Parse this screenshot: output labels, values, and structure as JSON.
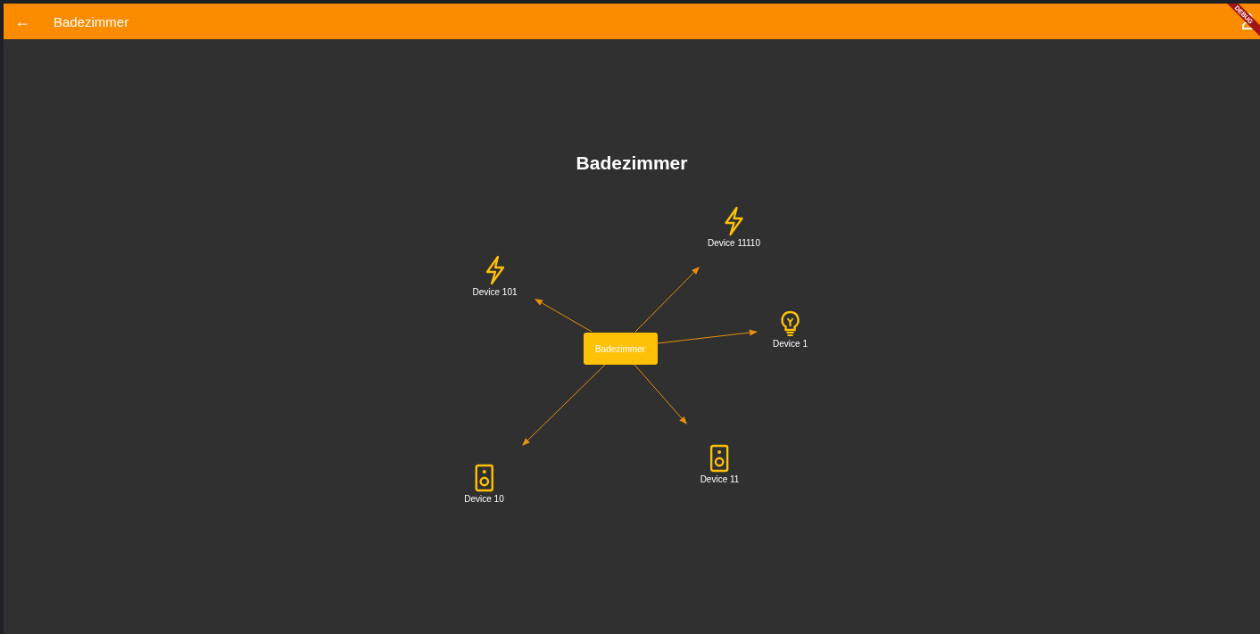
{
  "app_bar": {
    "back": "←",
    "title": "Badezimmer"
  },
  "debug_banner": "DEBUG",
  "heading": "Badezimmer",
  "diagram": {
    "center": "Badezimmer",
    "devices": [
      {
        "name": "Device 11110",
        "kind": "bolt"
      },
      {
        "name": "Device 101",
        "kind": "bolt"
      },
      {
        "name": "Device 1",
        "kind": "bulb"
      },
      {
        "name": "Device 11",
        "kind": "speaker"
      },
      {
        "name": "Device 10",
        "kind": "speaker"
      }
    ]
  }
}
